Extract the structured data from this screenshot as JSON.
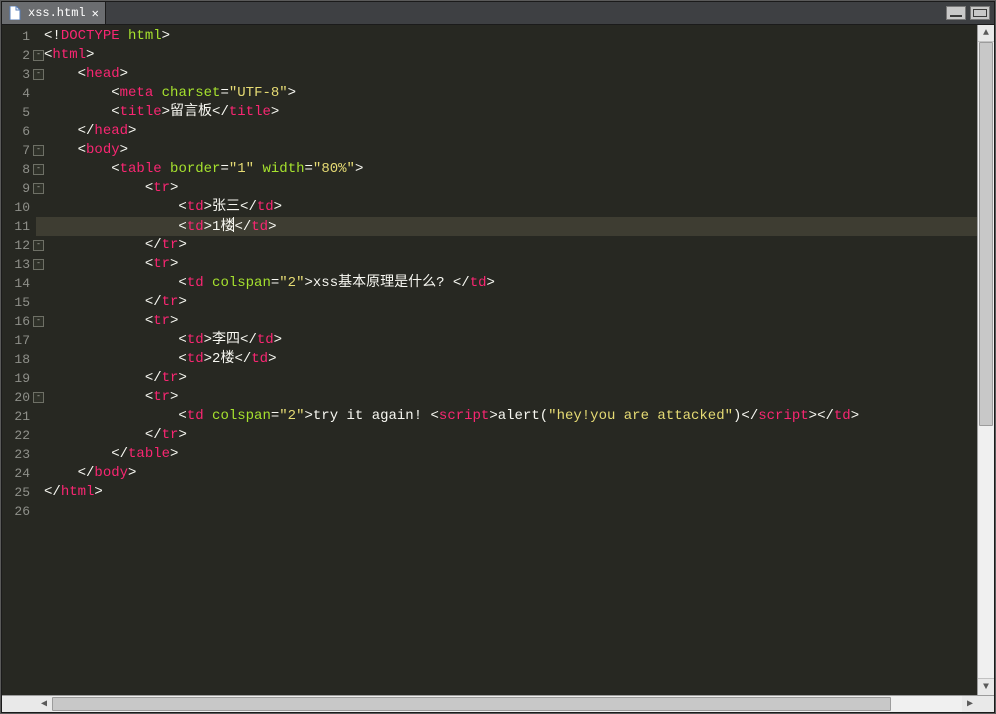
{
  "tab": {
    "filename": "xss.html"
  },
  "highlight_line_index": 10,
  "fold_lines": [
    1,
    2,
    6,
    7,
    8,
    11,
    12,
    15,
    19
  ],
  "code_lines": [
    [
      {
        "t": "<!",
        "c": "c-punc"
      },
      {
        "t": "DOCTYPE",
        "c": "c-tag"
      },
      {
        "t": " ",
        "c": "c-punc"
      },
      {
        "t": "html",
        "c": "c-attr"
      },
      {
        "t": ">",
        "c": "c-punc"
      }
    ],
    [
      {
        "t": "<",
        "c": "c-punc"
      },
      {
        "t": "html",
        "c": "c-tag"
      },
      {
        "t": ">",
        "c": "c-punc"
      }
    ],
    [
      {
        "t": "    ",
        "c": "c-punc"
      },
      {
        "t": "<",
        "c": "c-punc"
      },
      {
        "t": "head",
        "c": "c-tag"
      },
      {
        "t": ">",
        "c": "c-punc"
      }
    ],
    [
      {
        "t": "        ",
        "c": "c-punc"
      },
      {
        "t": "<",
        "c": "c-punc"
      },
      {
        "t": "meta",
        "c": "c-tag"
      },
      {
        "t": " ",
        "c": "c-punc"
      },
      {
        "t": "charset",
        "c": "c-attr"
      },
      {
        "t": "=",
        "c": "c-punc"
      },
      {
        "t": "\"UTF-8\"",
        "c": "c-str"
      },
      {
        "t": ">",
        "c": "c-punc"
      }
    ],
    [
      {
        "t": "        ",
        "c": "c-punc"
      },
      {
        "t": "<",
        "c": "c-punc"
      },
      {
        "t": "title",
        "c": "c-tag"
      },
      {
        "t": ">",
        "c": "c-punc"
      },
      {
        "t": "留言板",
        "c": "c-text"
      },
      {
        "t": "</",
        "c": "c-punc"
      },
      {
        "t": "title",
        "c": "c-tag"
      },
      {
        "t": ">",
        "c": "c-punc"
      }
    ],
    [
      {
        "t": "    ",
        "c": "c-punc"
      },
      {
        "t": "</",
        "c": "c-punc"
      },
      {
        "t": "head",
        "c": "c-tag"
      },
      {
        "t": ">",
        "c": "c-punc"
      }
    ],
    [
      {
        "t": "    ",
        "c": "c-punc"
      },
      {
        "t": "<",
        "c": "c-punc"
      },
      {
        "t": "body",
        "c": "c-tag"
      },
      {
        "t": ">",
        "c": "c-punc"
      }
    ],
    [
      {
        "t": "        ",
        "c": "c-punc"
      },
      {
        "t": "<",
        "c": "c-punc"
      },
      {
        "t": "table",
        "c": "c-tag"
      },
      {
        "t": " ",
        "c": "c-punc"
      },
      {
        "t": "border",
        "c": "c-attr"
      },
      {
        "t": "=",
        "c": "c-punc"
      },
      {
        "t": "\"1\"",
        "c": "c-str"
      },
      {
        "t": " ",
        "c": "c-punc"
      },
      {
        "t": "width",
        "c": "c-attr"
      },
      {
        "t": "=",
        "c": "c-punc"
      },
      {
        "t": "\"80%\"",
        "c": "c-str"
      },
      {
        "t": ">",
        "c": "c-punc"
      }
    ],
    [
      {
        "t": "            ",
        "c": "c-punc"
      },
      {
        "t": "<",
        "c": "c-punc"
      },
      {
        "t": "tr",
        "c": "c-tag"
      },
      {
        "t": ">",
        "c": "c-punc"
      }
    ],
    [
      {
        "t": "                ",
        "c": "c-punc"
      },
      {
        "t": "<",
        "c": "c-punc"
      },
      {
        "t": "td",
        "c": "c-tag"
      },
      {
        "t": ">",
        "c": "c-punc"
      },
      {
        "t": "张三",
        "c": "c-text"
      },
      {
        "t": "</",
        "c": "c-punc"
      },
      {
        "t": "td",
        "c": "c-tag"
      },
      {
        "t": ">",
        "c": "c-punc"
      }
    ],
    [
      {
        "t": "                ",
        "c": "c-punc"
      },
      {
        "t": "<",
        "c": "c-punc"
      },
      {
        "t": "td",
        "c": "c-tag"
      },
      {
        "t": ">",
        "c": "c-punc"
      },
      {
        "t": "1楼",
        "c": "c-text"
      },
      {
        "caret": true
      },
      {
        "t": "</",
        "c": "c-punc"
      },
      {
        "t": "td",
        "c": "c-tag"
      },
      {
        "t": ">",
        "c": "c-punc"
      }
    ],
    [
      {
        "t": "            ",
        "c": "c-punc"
      },
      {
        "t": "</",
        "c": "c-punc"
      },
      {
        "t": "tr",
        "c": "c-tag"
      },
      {
        "t": ">",
        "c": "c-punc"
      }
    ],
    [
      {
        "t": "            ",
        "c": "c-punc"
      },
      {
        "t": "<",
        "c": "c-punc"
      },
      {
        "t": "tr",
        "c": "c-tag"
      },
      {
        "t": ">",
        "c": "c-punc"
      }
    ],
    [
      {
        "t": "                ",
        "c": "c-punc"
      },
      {
        "t": "<",
        "c": "c-punc"
      },
      {
        "t": "td",
        "c": "c-tag"
      },
      {
        "t": " ",
        "c": "c-punc"
      },
      {
        "t": "colspan",
        "c": "c-attr"
      },
      {
        "t": "=",
        "c": "c-punc"
      },
      {
        "t": "\"2\"",
        "c": "c-str"
      },
      {
        "t": ">",
        "c": "c-punc"
      },
      {
        "t": "xss基本原理是什么? ",
        "c": "c-text"
      },
      {
        "t": "</",
        "c": "c-punc"
      },
      {
        "t": "td",
        "c": "c-tag"
      },
      {
        "t": ">",
        "c": "c-punc"
      }
    ],
    [
      {
        "t": "            ",
        "c": "c-punc"
      },
      {
        "t": "</",
        "c": "c-punc"
      },
      {
        "t": "tr",
        "c": "c-tag"
      },
      {
        "t": ">",
        "c": "c-punc"
      }
    ],
    [
      {
        "t": "            ",
        "c": "c-punc"
      },
      {
        "t": "<",
        "c": "c-punc"
      },
      {
        "t": "tr",
        "c": "c-tag"
      },
      {
        "t": ">",
        "c": "c-punc"
      }
    ],
    [
      {
        "t": "                ",
        "c": "c-punc"
      },
      {
        "t": "<",
        "c": "c-punc"
      },
      {
        "t": "td",
        "c": "c-tag"
      },
      {
        "t": ">",
        "c": "c-punc"
      },
      {
        "t": "李四",
        "c": "c-text"
      },
      {
        "t": "</",
        "c": "c-punc"
      },
      {
        "t": "td",
        "c": "c-tag"
      },
      {
        "t": ">",
        "c": "c-punc"
      }
    ],
    [
      {
        "t": "                ",
        "c": "c-punc"
      },
      {
        "t": "<",
        "c": "c-punc"
      },
      {
        "t": "td",
        "c": "c-tag"
      },
      {
        "t": ">",
        "c": "c-punc"
      },
      {
        "t": "2楼",
        "c": "c-text"
      },
      {
        "t": "</",
        "c": "c-punc"
      },
      {
        "t": "td",
        "c": "c-tag"
      },
      {
        "t": ">",
        "c": "c-punc"
      }
    ],
    [
      {
        "t": "            ",
        "c": "c-punc"
      },
      {
        "t": "</",
        "c": "c-punc"
      },
      {
        "t": "tr",
        "c": "c-tag"
      },
      {
        "t": ">",
        "c": "c-punc"
      }
    ],
    [
      {
        "t": "            ",
        "c": "c-punc"
      },
      {
        "t": "<",
        "c": "c-punc"
      },
      {
        "t": "tr",
        "c": "c-tag"
      },
      {
        "t": ">",
        "c": "c-punc"
      }
    ],
    [
      {
        "t": "                ",
        "c": "c-punc"
      },
      {
        "t": "<",
        "c": "c-punc"
      },
      {
        "t": "td",
        "c": "c-tag"
      },
      {
        "t": " ",
        "c": "c-punc"
      },
      {
        "t": "colspan",
        "c": "c-attr"
      },
      {
        "t": "=",
        "c": "c-punc"
      },
      {
        "t": "\"2\"",
        "c": "c-str"
      },
      {
        "t": ">",
        "c": "c-punc"
      },
      {
        "t": "try it again! ",
        "c": "c-text"
      },
      {
        "t": "<",
        "c": "c-punc"
      },
      {
        "t": "script",
        "c": "c-tag"
      },
      {
        "t": ">",
        "c": "c-punc"
      },
      {
        "t": "alert(",
        "c": "c-text"
      },
      {
        "t": "\"hey!you are attacked\"",
        "c": "c-str"
      },
      {
        "t": ")",
        "c": "c-text"
      },
      {
        "t": "</",
        "c": "c-punc"
      },
      {
        "t": "script",
        "c": "c-tag"
      },
      {
        "t": ">",
        "c": "c-punc"
      },
      {
        "t": "</",
        "c": "c-punc"
      },
      {
        "t": "td",
        "c": "c-tag"
      },
      {
        "t": ">",
        "c": "c-punc"
      }
    ],
    [
      {
        "t": "            ",
        "c": "c-punc"
      },
      {
        "t": "</",
        "c": "c-punc"
      },
      {
        "t": "tr",
        "c": "c-tag"
      },
      {
        "t": ">",
        "c": "c-punc"
      }
    ],
    [
      {
        "t": "        ",
        "c": "c-punc"
      },
      {
        "t": "</",
        "c": "c-punc"
      },
      {
        "t": "table",
        "c": "c-tag"
      },
      {
        "t": ">",
        "c": "c-punc"
      }
    ],
    [
      {
        "t": "    ",
        "c": "c-punc"
      },
      {
        "t": "</",
        "c": "c-punc"
      },
      {
        "t": "body",
        "c": "c-tag"
      },
      {
        "t": ">",
        "c": "c-punc"
      }
    ],
    [
      {
        "t": "</",
        "c": "c-punc"
      },
      {
        "t": "html",
        "c": "c-tag"
      },
      {
        "t": ">",
        "c": "c-punc"
      }
    ],
    []
  ]
}
